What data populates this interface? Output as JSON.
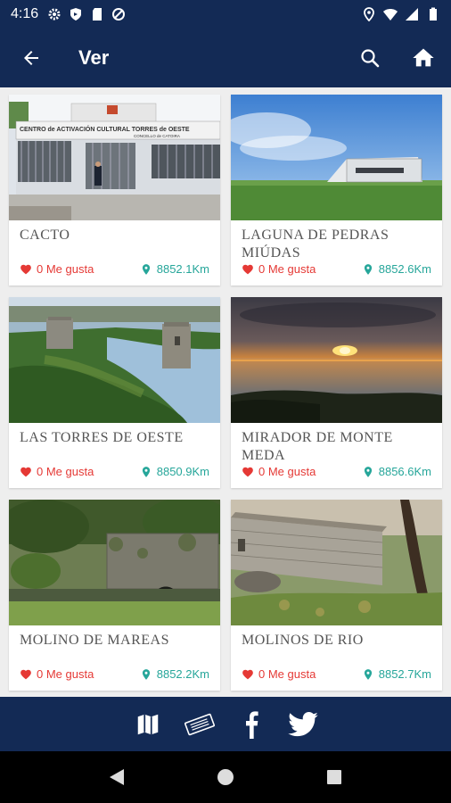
{
  "status_bar": {
    "time": "4:16"
  },
  "toolbar": {
    "title": "Ver"
  },
  "cards": [
    {
      "title": "CACTO",
      "likes": "0 Me gusta",
      "distance": "8852.1Km",
      "sign_text": "CENTRO de ACTIVACIÓN CULTURAL TORRES de OESTE",
      "sign_subtext": "CONCELLO de CATOIRA"
    },
    {
      "title": "LAGUNA DE PEDRAS MIÚDAS",
      "likes": "0 Me gusta",
      "distance": "8852.6Km"
    },
    {
      "title": "LAS TORRES DE OESTE",
      "likes": "0 Me gusta",
      "distance": "8850.9Km"
    },
    {
      "title": "MIRADOR DE MONTE MEDA",
      "likes": "0 Me gusta",
      "distance": "8856.6Km"
    },
    {
      "title": "MOLINO DE MAREAS",
      "likes": "0 Me gusta",
      "distance": "8852.2Km"
    },
    {
      "title": "MOLINOS DE RIO",
      "likes": "0 Me gusta",
      "distance": "8852.7Km"
    }
  ],
  "colors": {
    "primary": "#132a55",
    "like": "#e53935",
    "distance": "#26a69a"
  },
  "icons": {
    "status_left": [
      "gear-icon",
      "shield-icon",
      "sd-card-icon",
      "sync-icon"
    ],
    "status_right": [
      "location-icon",
      "wifi-icon",
      "signal-icon",
      "battery-icon"
    ],
    "toolbar": [
      "back-arrow-icon",
      "search-icon",
      "home-icon"
    ],
    "social": [
      "map-icon",
      "ticket-icon",
      "facebook-icon",
      "twitter-icon"
    ],
    "nav": [
      "back-triangle-icon",
      "home-circle-icon",
      "recents-square-icon"
    ]
  }
}
